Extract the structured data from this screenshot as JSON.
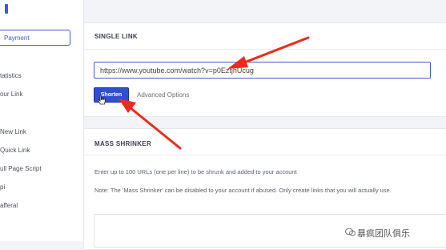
{
  "sidebar": {
    "payment_label": "Payment",
    "items": [
      {
        "label": "tatistics"
      },
      {
        "label": "our Link"
      },
      {
        "label": "New Link"
      },
      {
        "label": "Quick Link"
      },
      {
        "label": "ull Page Script"
      },
      {
        "label": "pi"
      },
      {
        "label": "afferal"
      }
    ]
  },
  "single_link": {
    "title": "SINGLE LINK",
    "url_value": "https://www.youtube.com/watch?v=p0EztjhUcug",
    "shorten_label": "Shorten",
    "advanced_label": "Advanced Options"
  },
  "mass_shrinker": {
    "title": "MASS SHRINKER",
    "instruction": "Enter up to 100 URLs (one per line) to be shrunk and added to your account",
    "note": "Note: The 'Mass Shrinker' can be disabled to your account if abused. Only create links that you will actually use."
  },
  "watermark": {
    "text": "暴疯团队俱乐"
  },
  "colors": {
    "accent": "#3b5bd6",
    "button": "#2f4fd1",
    "arrow": "#f02a1a"
  }
}
